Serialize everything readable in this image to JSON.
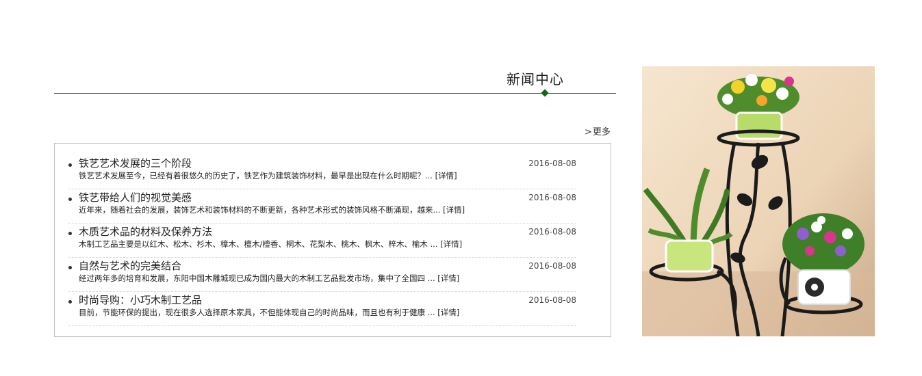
{
  "section": {
    "title": "新闻中心",
    "more": "更多",
    "more_prefix": ">"
  },
  "news": [
    {
      "title": "铁艺艺术发展的三个阶段",
      "date": "2016-08-08",
      "summary": "铁艺艺术发展至今，已经有着很悠久的历史了，铁艺作为建筑装饰材料，最早是出现在什么时期呢？...",
      "detail": "[详情]"
    },
    {
      "title": "铁艺带给人们的视觉美感",
      "date": "2016-08-08",
      "summary": "近年来，随着社会的发展，装饰艺术和装饰材料的不断更新，各种艺术形式的装饰风格不断涌现，越来...",
      "detail": "[详情]"
    },
    {
      "title": "木质艺术品的材料及保养方法",
      "date": "2016-08-08",
      "summary": "木制工艺品主要是以红木、松木、杉木、樟木、檀木/檀香、桐木、花梨木、桃木、枫木、梓木、榆木 ...",
      "detail": "[详情]"
    },
    {
      "title": "自然与艺术的完美结合",
      "date": "2016-08-08",
      "summary": "经过两年多的培育和发展，东阳中国木雕城现已成为国内最大的木制工艺品批发市场，集中了全国四 ...",
      "detail": "[详情]"
    },
    {
      "title": "时尚导购：小巧木制工艺品",
      "date": "2016-08-08",
      "summary": "目前，节能环保的提出，现在很多人选择原木家具，不但能体现自己的时尚品味，而且也有利于健康 ...",
      "detail": "[详情]"
    }
  ],
  "colors": {
    "accent": "#0f6a0f",
    "border": "#bdbdbd",
    "photo_bg": "#f0dcc2"
  },
  "photo": {
    "icon": "flower-stand-photo"
  }
}
